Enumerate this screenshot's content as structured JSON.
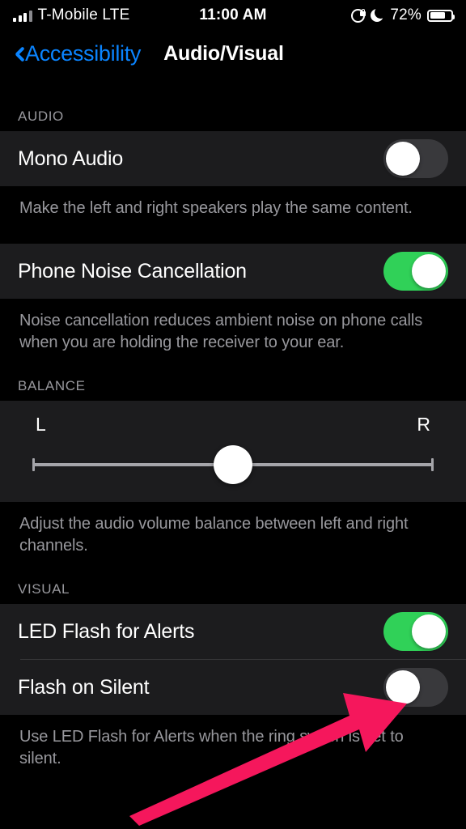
{
  "status_bar": {
    "carrier": "T-Mobile",
    "network": "LTE",
    "carrier_full": "T-Mobile LTE",
    "time": "11:00 AM",
    "battery_percent": "72%",
    "icons": [
      "signal-bars-icon",
      "rotation-lock-icon",
      "do-not-disturb-moon-icon",
      "battery-icon"
    ]
  },
  "nav": {
    "back_label": "Accessibility",
    "title": "Audio/Visual"
  },
  "sections": {
    "audio": {
      "header": "AUDIO",
      "mono_audio": {
        "label": "Mono Audio",
        "state": "off",
        "footer": "Make the left and right speakers play the same content."
      },
      "noise_cancellation": {
        "label": "Phone Noise Cancellation",
        "state": "on",
        "footer": "Noise cancellation reduces ambient noise on phone calls when you are holding the receiver to your ear."
      }
    },
    "balance": {
      "header": "BALANCE",
      "left_label": "L",
      "right_label": "R",
      "value": 50,
      "footer": "Adjust the audio volume balance between left and right channels."
    },
    "visual": {
      "header": "VISUAL",
      "led_flash": {
        "label": "LED Flash for Alerts",
        "state": "on"
      },
      "flash_on_silent": {
        "label": "Flash on Silent",
        "state": "off"
      },
      "footer": "Use LED Flash for Alerts when the ring switch is set to silent."
    }
  },
  "annotation": {
    "type": "arrow",
    "color": "#f5175c",
    "points_to": "flash-on-silent-toggle"
  },
  "colors": {
    "background": "#000000",
    "card": "#1c1c1e",
    "accent_blue": "#0a84ff",
    "toggle_on_green": "#30d158",
    "toggle_off_gray": "#39393c",
    "secondary_text": "#98989d"
  }
}
